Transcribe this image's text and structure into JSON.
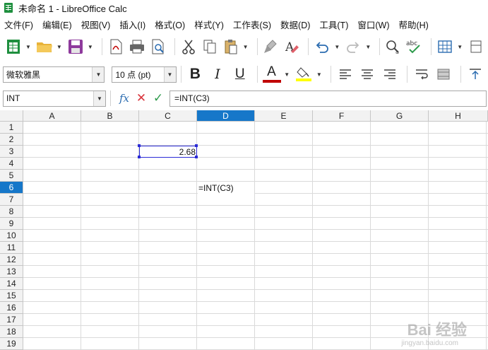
{
  "window": {
    "title": "未命名 1 - LibreOffice Calc"
  },
  "menubar": {
    "items": [
      "文件(F)",
      "编辑(E)",
      "视图(V)",
      "插入(I)",
      "格式(O)",
      "样式(Y)",
      "工作表(S)",
      "数据(D)",
      "工具(T)",
      "窗口(W)",
      "帮助(H)"
    ]
  },
  "toolbar": {
    "icons": [
      "new-spreadsheet-icon",
      "open-folder-icon",
      "save-icon",
      "export-pdf-icon",
      "print-icon",
      "print-preview-icon",
      "cut-icon",
      "copy-icon",
      "paste-icon",
      "clone-formatting-icon",
      "clear-formatting-icon",
      "undo-icon",
      "redo-icon",
      "find-replace-icon",
      "spellcheck-icon",
      "borders-icon",
      "column-icon"
    ]
  },
  "format_toolbar": {
    "font_name": "微软雅黑",
    "font_size": "10 点 (pt)",
    "bold": "B",
    "italic": "I",
    "underline": "U",
    "font_color_letter": "A",
    "accent": "#c00000",
    "highlight": "#ffff00"
  },
  "formula_bar": {
    "name_box": "INT",
    "fx": "fx",
    "cancel": "✕",
    "accept": "✓",
    "formula": "=INT(C3)"
  },
  "sheet": {
    "columns": [
      "A",
      "B",
      "C",
      "D",
      "E",
      "F",
      "G",
      "H"
    ],
    "rows": [
      "1",
      "2",
      "3",
      "4",
      "5",
      "6",
      "7",
      "8",
      "9",
      "10",
      "11",
      "12",
      "13",
      "14",
      "15",
      "16",
      "17",
      "18",
      "19"
    ],
    "active_column": "D",
    "active_row": "6",
    "cell_c3": "2.68",
    "cell_d6": "=INT(C3)",
    "selection_color": "#1677c9"
  },
  "watermark": {
    "text": "Bai 经验",
    "sub": "jingyan.baidu.com"
  }
}
